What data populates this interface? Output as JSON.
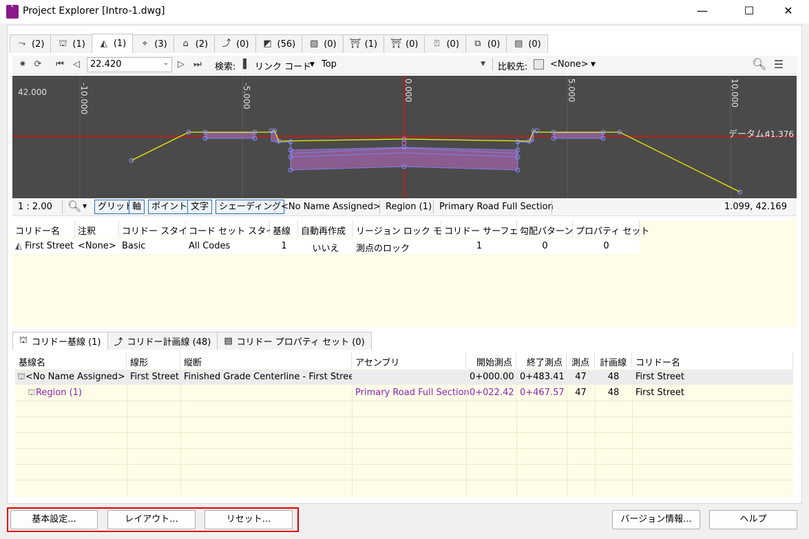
{
  "window": {
    "title": "Project Explorer [Intro-1.dwg]",
    "app_icon_letter": "C",
    "app_icon_sub": "C3D",
    "minimize": "—",
    "maximize": "☐",
    "close": "✕"
  },
  "tabs": [
    {
      "icon": "alignment-icon",
      "glyph": "⤳",
      "count": "(2)"
    },
    {
      "icon": "baseline-icon",
      "glyph": "⛫",
      "count": "(1)"
    },
    {
      "icon": "corridor-icon",
      "glyph": "◭",
      "count": "(1)",
      "active": true
    },
    {
      "icon": "assembly-icon",
      "glyph": "⌖",
      "count": "(3)"
    },
    {
      "icon": "surface-icon",
      "glyph": "⌂",
      "count": "(2)"
    },
    {
      "icon": "featureline-icon",
      "glyph": "⤴",
      "count": "(0)"
    },
    {
      "icon": "profile-icon",
      "glyph": "◩",
      "count": "(56)"
    },
    {
      "icon": "map-icon",
      "glyph": "▧",
      "count": "(0)"
    },
    {
      "icon": "pipe-icon",
      "glyph": "⛩",
      "count": "(1)"
    },
    {
      "icon": "structure-icon",
      "glyph": "⛩",
      "count": "(0)"
    },
    {
      "icon": "parcel-icon",
      "glyph": "⍐",
      "count": "(0)"
    },
    {
      "icon": "sample-icon",
      "glyph": "⧉",
      "count": "(0)"
    },
    {
      "icon": "sheet-icon",
      "glyph": "▤",
      "count": "(0)"
    }
  ],
  "toolbar": {
    "station_value": "22.420",
    "search_label": "検索:",
    "search_mode": "リンク コード",
    "search_value": "Top",
    "compare_label": "比較先:",
    "compare_value": "<None>"
  },
  "viewer": {
    "y_label": "42.000",
    "x_ticks": [
      "-10.000",
      "-5.000",
      "0.000",
      "5.000",
      "10.000"
    ],
    "datum_label": "データム:",
    "datum_value": "41.376"
  },
  "viewer_status": {
    "scale": "1 : 2.00",
    "btn_grid": "グリッド",
    "btn_axis": "軸",
    "btn_point": "ポイント",
    "btn_text": "文字",
    "btn_shading": "シェーディング",
    "baseline": "<No Name Assigned>",
    "region": "Region (1)",
    "assembly": "Primary Road Full Section",
    "coords": "1.099, 42.169"
  },
  "corridor_table": {
    "headers": [
      "コリドー名",
      "注釈",
      "コリドー スタイル",
      "コード セット スタイル",
      "基線",
      "自動再作成",
      "リージョン ロック モード",
      "コリドー サーフェス",
      "勾配パターン",
      "プロパティ セット"
    ],
    "row": [
      "First Street",
      "<None>",
      "Basic",
      "All Codes",
      "1",
      "いいえ",
      "測点のロック",
      "1",
      "0",
      "0"
    ]
  },
  "lower_tabs": [
    {
      "label": "コリドー基線 (1)",
      "active": true
    },
    {
      "label": "コリドー計画線 (48)"
    },
    {
      "label": "コリドー プロパティ セット (0)"
    }
  ],
  "baseline_table": {
    "headers": [
      "基線名",
      "線形",
      "縦断",
      "アセンブリ",
      "開始測点",
      "終了測点",
      "測点",
      "計画線",
      "コリドー名"
    ],
    "row1": [
      "<No Name Assigned>",
      "First Street",
      "Finished Grade Centerline - First Street",
      "",
      "0+000.00",
      "0+483.41",
      "47",
      "48",
      "First Street"
    ],
    "row2": [
      "Region (1)",
      "",
      "",
      "Primary Road Full Section",
      "0+022.42",
      "0+467.57",
      "47",
      "48",
      "First Street"
    ]
  },
  "buttons": {
    "settings": "基本設定...",
    "layout": "レイアウト...",
    "reset": "リセット...",
    "version": "バージョン情報...",
    "help": "ヘルプ"
  },
  "colors": {
    "viewer_bg": "#4a4a4a",
    "crosshair": "#e01010",
    "section_fill": "#8a5c8f",
    "top_link": "#f0f000",
    "highlight": "#e00000"
  }
}
